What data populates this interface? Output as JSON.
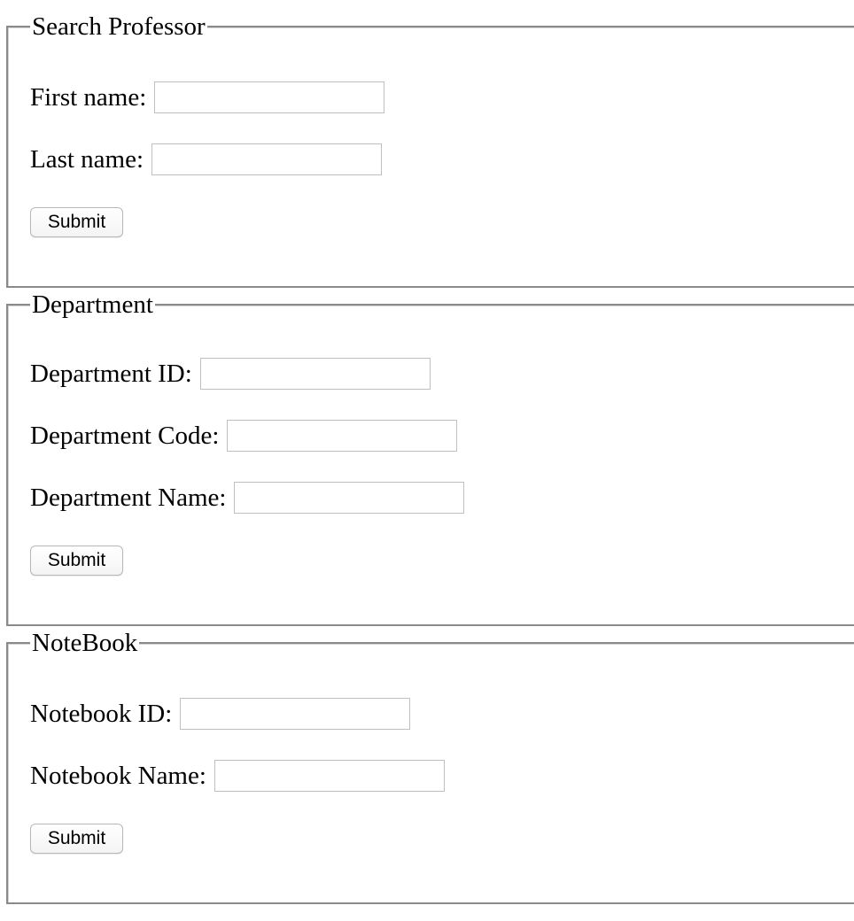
{
  "professor": {
    "legend": "Search Professor",
    "first_name_label": "First name:",
    "first_name_value": "",
    "last_name_label": "Last name:",
    "last_name_value": "",
    "submit_label": "Submit"
  },
  "department": {
    "legend": "Department",
    "id_label": "Department ID:",
    "id_value": "",
    "code_label": "Department Code:",
    "code_value": "",
    "name_label": "Department Name:",
    "name_value": "",
    "submit_label": "Submit"
  },
  "notebook": {
    "legend": "NoteBook",
    "id_label": "Notebook ID:",
    "id_value": "",
    "name_label": "Notebook Name:",
    "name_value": "",
    "submit_label": "Submit"
  }
}
